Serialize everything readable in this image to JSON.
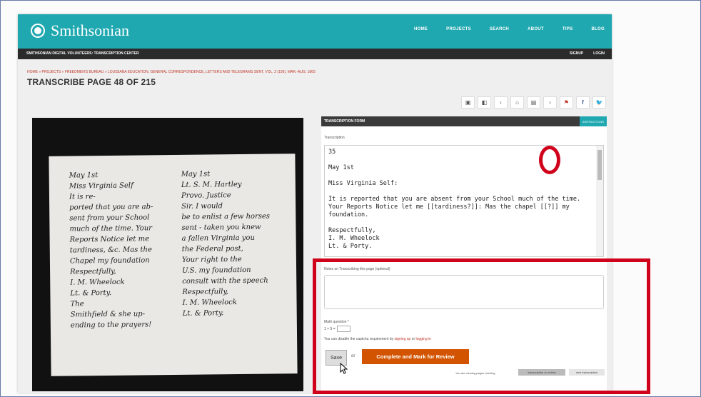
{
  "site": {
    "logo_text": "Smithsonian",
    "nav": [
      "HOME",
      "PROJECTS",
      "SEARCH",
      "ABOUT",
      "TIPS",
      "BLOG"
    ],
    "subbar_title": "SMITHSONIAN DIGITAL VOLUNTEERS: TRANSCRIPTION CENTER",
    "subbar_links": [
      "SIGNUP",
      "LOGIN"
    ]
  },
  "breadcrumb": "HOME » PROJECTS » FREEDMEN'S BUREAU » LOUISIANA EDUCATION, GENERAL CORRESPONDENCE, LETTERS AND TELEGRAMS SENT, VOL. 2 (195), MAR.-AUG. 1865",
  "page_title": "TRANSCRIBE PAGE 48 OF 215",
  "toolbar_icons": [
    "print-icon",
    "layout-icon",
    "prev-icon",
    "home-icon",
    "grid-icon",
    "next-icon",
    "bookmark-icon",
    "facebook-icon",
    "twitter-icon"
  ],
  "toolbar_glyphs": [
    "▣",
    "◧",
    "‹",
    "⌂",
    "▤",
    "›",
    "⚑",
    "f",
    "🐦"
  ],
  "form": {
    "header": "TRANSCRIPTION FORM",
    "header_button": "INSTRUCTIONS",
    "transcription_label": "Transcription",
    "transcription_value": "35\n\nMay 1st\n\nMiss Virginia Self:\n\nIt is reported that you are absent from your School much of the time. Your Reports Notice let me [[tardiness?]]: Mas the chapel [[?]] my foundation.\n\nRespectfully,\nI. M. Wheelock\nLt. & Porty.",
    "notes_label": "Notes on Transcribing this page (optional)",
    "notes_value": "",
    "math_label": "Math question *",
    "math_question": "1 + 5 =",
    "captcha_prefix": "You can disable the captcha requirement by",
    "captcha_link1": "signing up",
    "captcha_or": "or",
    "captcha_link2": "logging in",
    "save_label": "Save",
    "or_label": "or",
    "complete_label": "Complete and Mark for Review",
    "viewing_text": "You are viewing pages needing",
    "view_btn1": "transcription or review",
    "view_btn2": "next transcription"
  },
  "document_lines_left": [
    "May 1st",
    "Miss Virginia Self",
    "It is re-",
    "ported that you are ab-",
    "sent from your School",
    "much of the time. Your",
    "Reports Notice let me",
    "tardiness, &c. Mas the",
    "Chapel my foundation",
    "Respectfully,",
    "I. M. Wheelock",
    "Lt. & Porty.",
    "The",
    "Smithfield & she up-",
    "ending to the prayers!"
  ],
  "document_lines_right": [
    "May 1st",
    "Lt. S. M. Hartley",
    "Provo. Justice",
    "Sir. I would",
    "be to enlist a few horses",
    "sent - taken you knew",
    "a fallen Virginia you",
    "the Federal post,",
    "Your right to the",
    "U.S. my foundation",
    "consult with the speech",
    "Respectfully,",
    "I. M. Wheelock",
    "Lt. & Porty."
  ]
}
